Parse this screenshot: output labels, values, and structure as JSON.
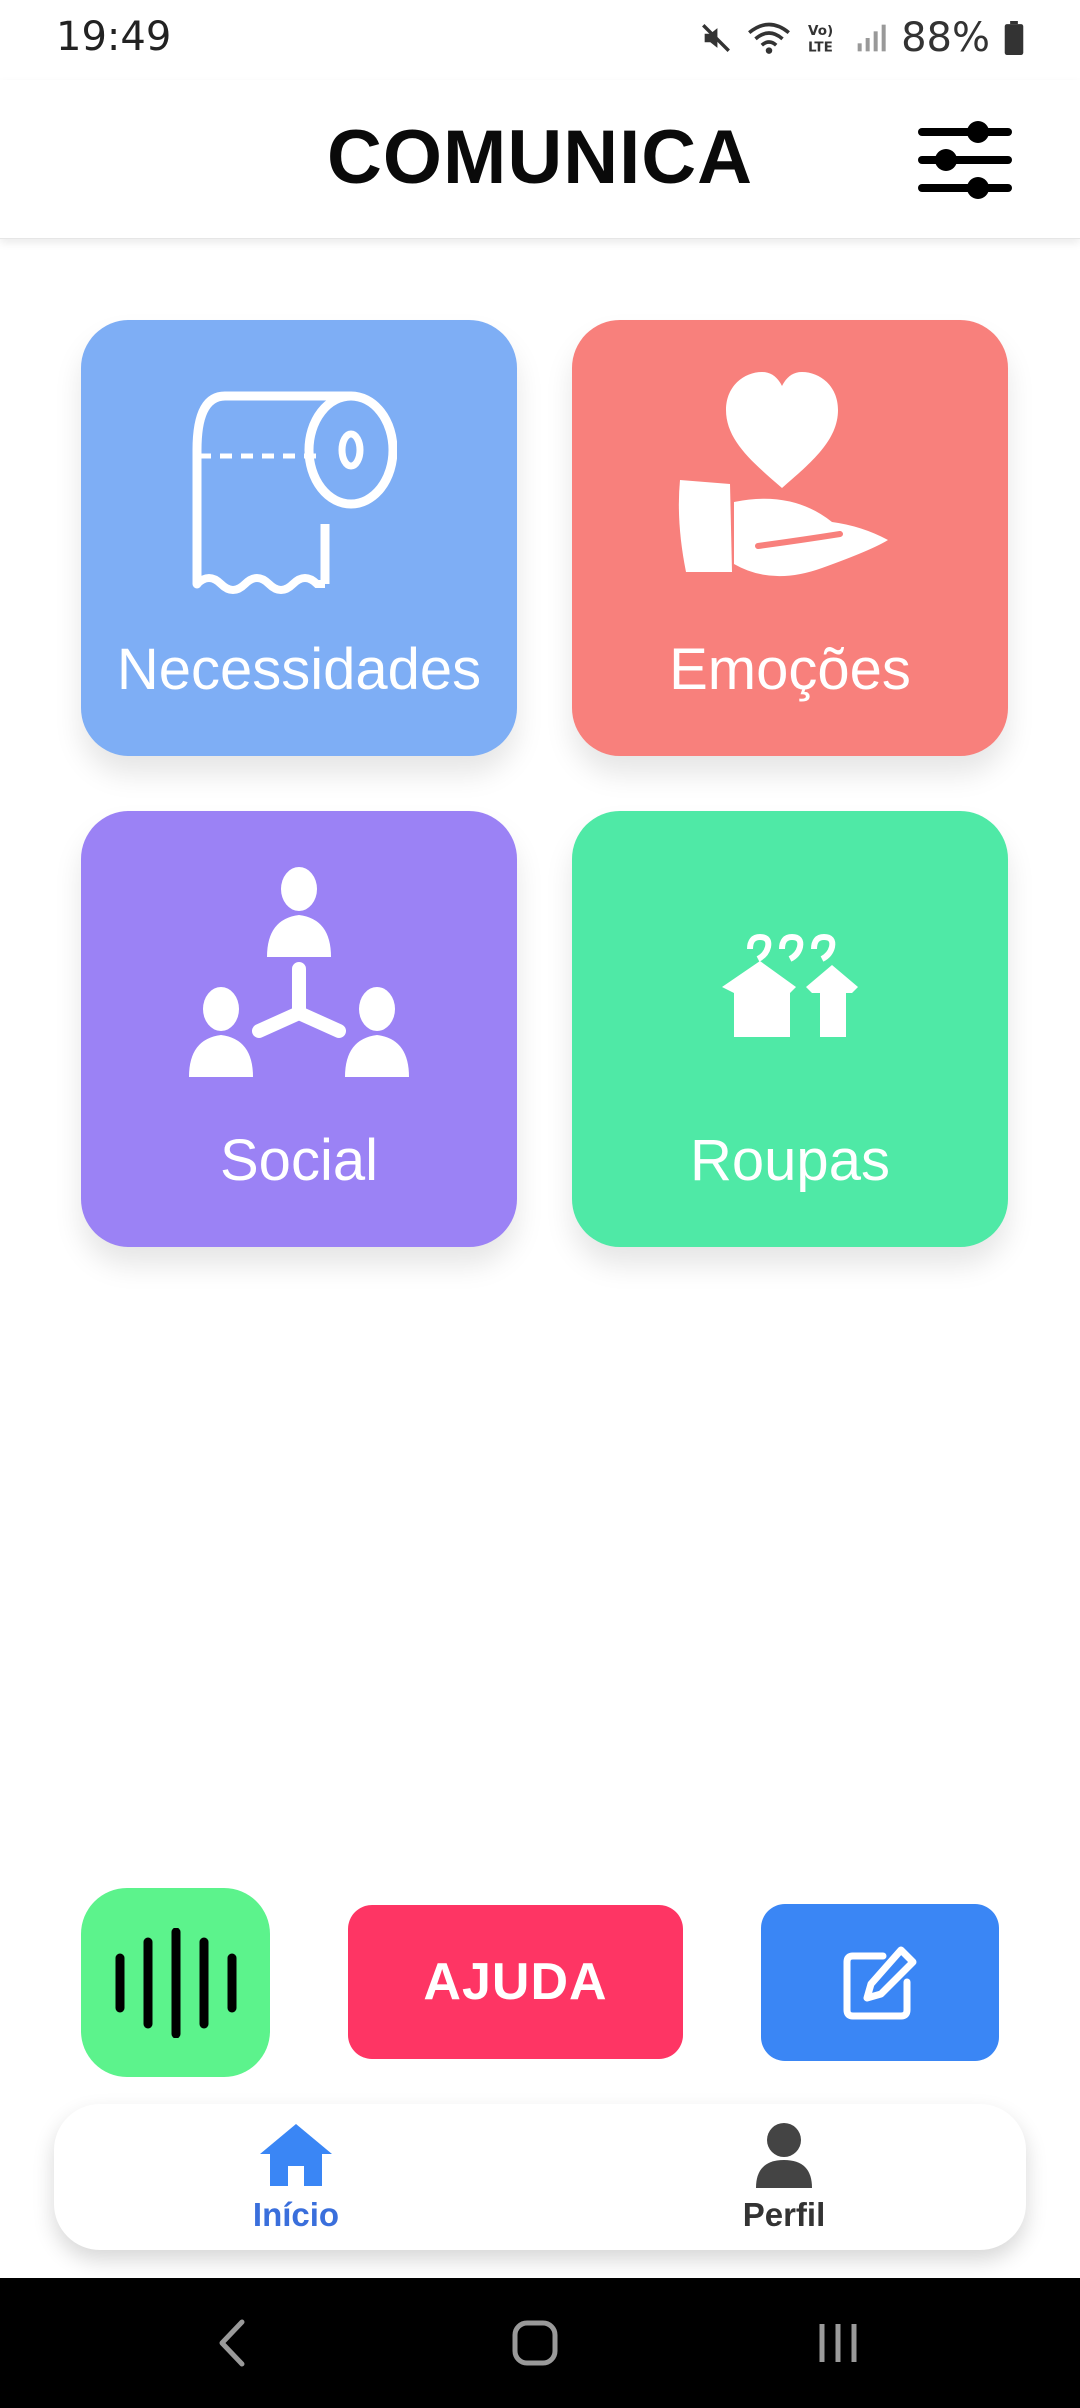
{
  "status_bar": {
    "time": "19:49",
    "battery": "88%"
  },
  "header": {
    "title": "COMUNICA",
    "settings_icon": "sliders-icon"
  },
  "categories": [
    {
      "label": "Necessidades",
      "icon": "toilet-paper-icon",
      "color": "#7eaef5"
    },
    {
      "label": "Emoções",
      "icon": "heart-hand-icon",
      "color": "#f8807c"
    },
    {
      "label": "Social",
      "icon": "people-network-icon",
      "color": "#9b82f5"
    },
    {
      "label": "Roupas",
      "icon": "clothes-hanger-icon",
      "color": "#4fe9a6"
    }
  ],
  "actions": {
    "voice_icon": "sound-wave-icon",
    "help_label": "AJUDA",
    "edit_icon": "edit-icon"
  },
  "bottom_nav": {
    "items": [
      {
        "label": "Início",
        "icon": "home-icon",
        "active": true,
        "color": "#3a6fdc"
      },
      {
        "label": "Perfil",
        "icon": "user-icon",
        "active": false,
        "color": "#333333"
      }
    ]
  }
}
